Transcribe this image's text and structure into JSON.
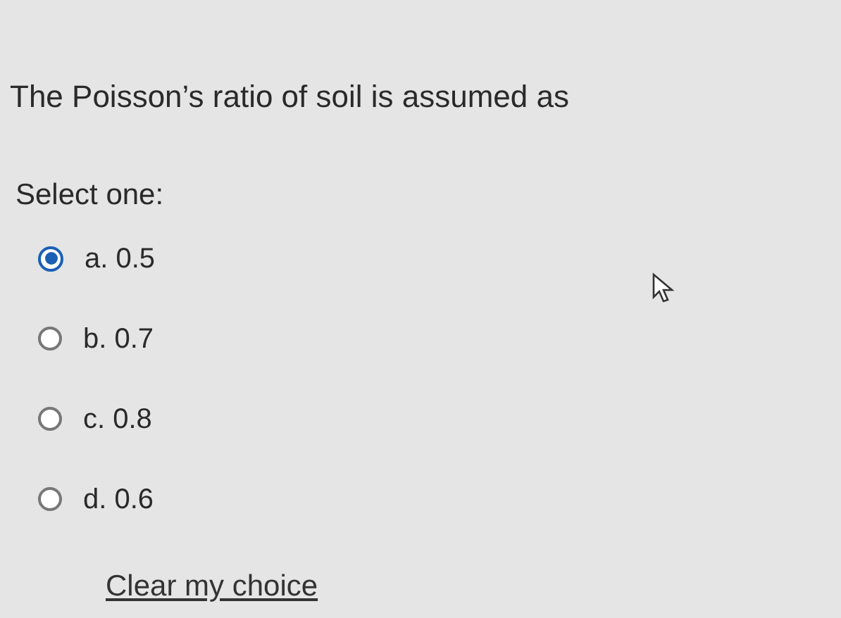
{
  "question": {
    "text": "The Poisson’s ratio of soil is assumed as"
  },
  "prompt": "Select one:",
  "options": [
    {
      "label": "a. 0.5",
      "selected": true
    },
    {
      "label": "b. 0.7",
      "selected": false
    },
    {
      "label": "c. 0.8",
      "selected": false
    },
    {
      "label": "d. 0.6",
      "selected": false
    }
  ],
  "clear_link": "Clear my choice"
}
